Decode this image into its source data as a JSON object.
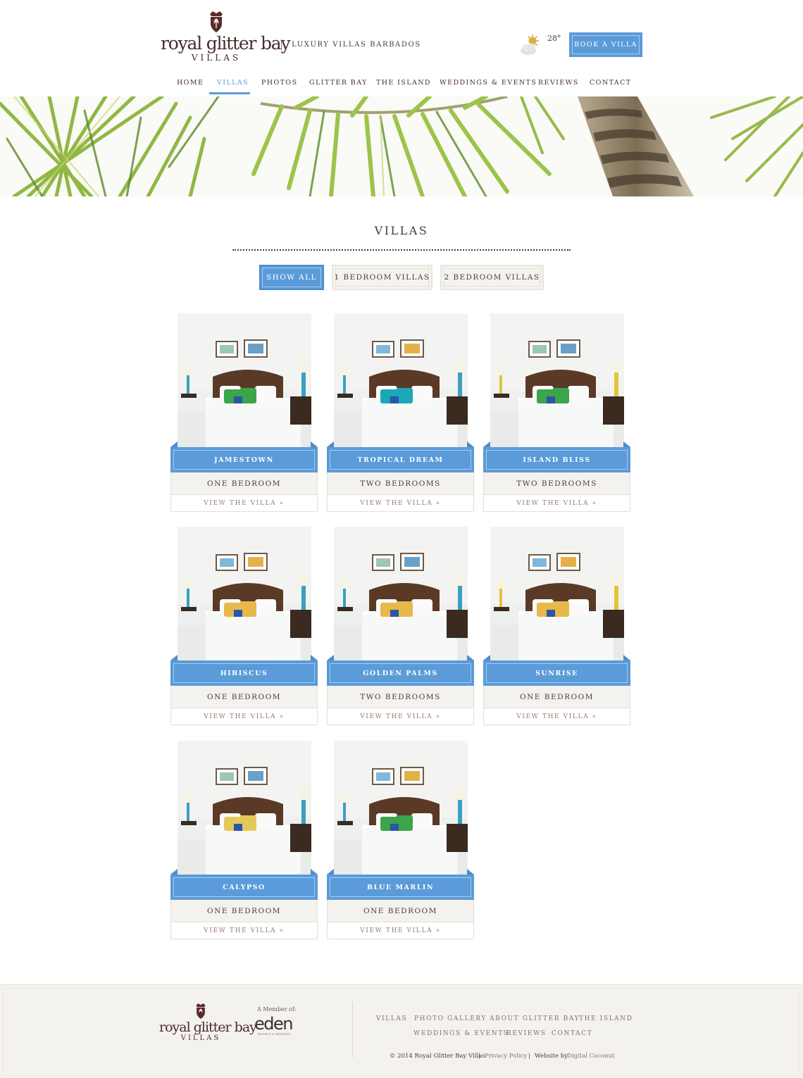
{
  "header": {
    "logo_main": "royal glitter bay",
    "logo_sub": "VILLAS",
    "tagline": "LUXURY VILLAS BARBADOS",
    "temperature": "28°",
    "weather_icon": "partly-cloudy-icon",
    "book_label": "BOOK A VILLA"
  },
  "nav": {
    "items": [
      "HOME",
      "VILLAS",
      "PHOTOS",
      "GLITTER BAY",
      "THE ISLAND",
      "WEDDINGS & EVENTS",
      "REVIEWS",
      "CONTACT"
    ],
    "active": "VILLAS"
  },
  "page": {
    "title": "VILLAS"
  },
  "filters": {
    "items": [
      "SHOW ALL",
      "1 BEDROOM VILLAS",
      "2 BEDROOM VILLAS"
    ],
    "active": "SHOW ALL"
  },
  "villas": [
    {
      "name": "JAMESTOWN",
      "bedrooms": "ONE BEDROOM",
      "link": "VIEW THE VILLA »",
      "pillow": "#3aa54a"
    },
    {
      "name": "TROPICAL DREAM",
      "bedrooms": "TWO BEDROOMS",
      "link": "VIEW THE VILLA »",
      "pillow": "#1aa8b8"
    },
    {
      "name": "ISLAND BLISS",
      "bedrooms": "TWO BEDROOMS",
      "link": "VIEW THE VILLA »",
      "pillow": "#3aa54a"
    },
    {
      "name": "HIBISCUS",
      "bedrooms": "ONE BEDROOM",
      "link": "VIEW THE VILLA »",
      "pillow": "#e8b84a"
    },
    {
      "name": "GOLDEN PALMS",
      "bedrooms": "TWO BEDROOMS",
      "link": "VIEW THE VILLA »",
      "pillow": "#e8b84a"
    },
    {
      "name": "SUNRISE",
      "bedrooms": "ONE BEDROOM",
      "link": "VIEW THE VILLA »",
      "pillow": "#e8b84a"
    },
    {
      "name": "CALYPSO",
      "bedrooms": "ONE BEDROOM",
      "link": "VIEW THE VILLA »",
      "pillow": "#e3c95a"
    },
    {
      "name": "BLUE MARLIN",
      "bedrooms": "ONE BEDROOM",
      "link": "VIEW THE VILLA »",
      "pillow": "#3aa54a"
    }
  ],
  "footer": {
    "logo_main": "royal glitter bay",
    "logo_sub": "VILLAS",
    "member_label": "A Member of:",
    "member_brand": "eden",
    "member_brand_sub": "HOTELS & RESORTS",
    "links_row1": [
      "VILLAS",
      "PHOTO GALLERY",
      "ABOUT GLITTER BAY",
      "THE ISLAND"
    ],
    "links_row2": [
      "WEDDINGS & EVENTS",
      "REVIEWS",
      "CONTACT"
    ],
    "copyright": "© 2014 Royal Glitter Bay Villas",
    "sep": "|",
    "privacy": "Privacy Policy",
    "website_by_label": "Website by",
    "website_by": "Digital Coconut"
  },
  "colors": {
    "accent": "#5b9bd9",
    "brand": "#4a2c2c",
    "footer_bg": "#f4f2ee"
  }
}
